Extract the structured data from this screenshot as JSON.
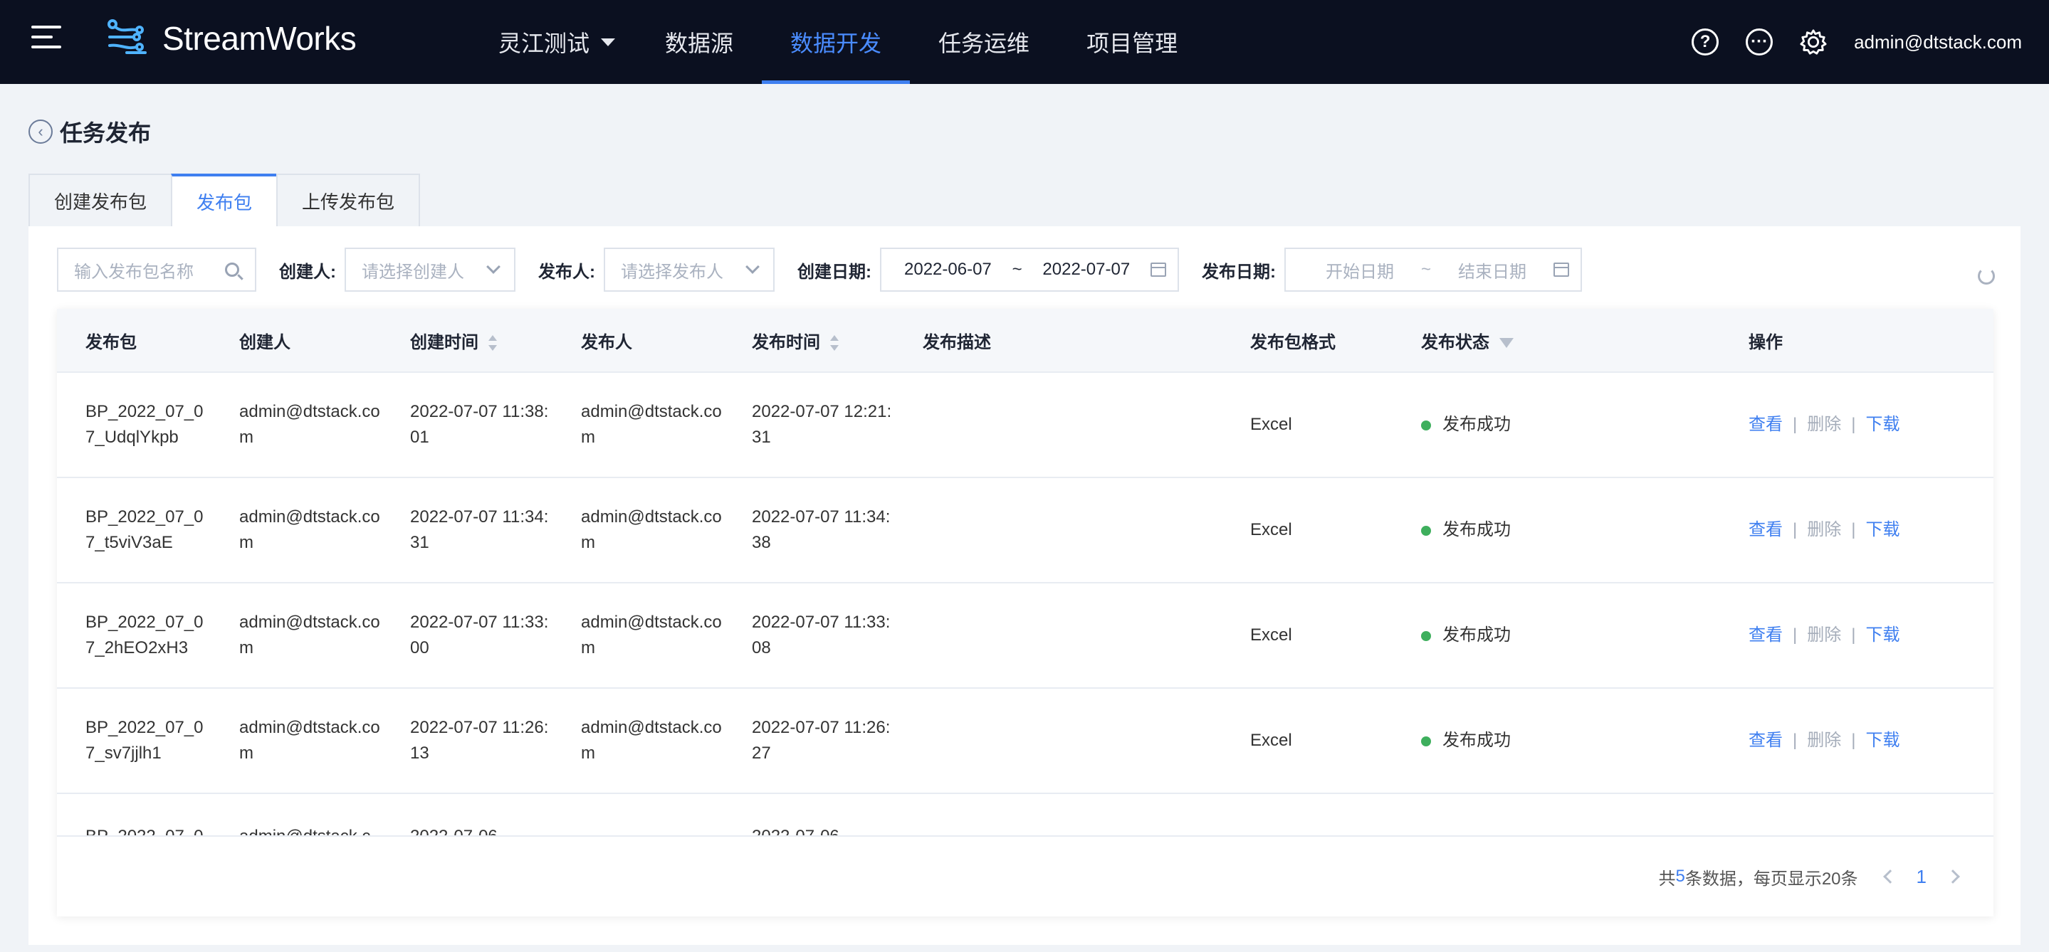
{
  "app": {
    "name": "StreamWorks"
  },
  "nav": {
    "project": "灵江测试",
    "items": [
      "数据源",
      "数据开发",
      "任务运维",
      "项目管理"
    ],
    "active": "数据开发"
  },
  "user": {
    "email": "admin@dtstack.com"
  },
  "page": {
    "title": "任务发布"
  },
  "tabs": [
    {
      "label": "创建发布包",
      "active": false
    },
    {
      "label": "发布包",
      "active": true
    },
    {
      "label": "上传发布包",
      "active": false
    }
  ],
  "filters": {
    "search_placeholder": "输入发布包名称",
    "creator_label": "创建人:",
    "creator_placeholder": "请选择创建人",
    "publisher_label": "发布人:",
    "publisher_placeholder": "请选择发布人",
    "create_date_label": "创建日期:",
    "create_date_start": "2022-06-07",
    "create_date_sep": "~",
    "create_date_end": "2022-07-07",
    "publish_date_label": "发布日期:",
    "publish_date_start": "开始日期",
    "publish_date_sep": "~",
    "publish_date_end": "结束日期"
  },
  "table": {
    "headers": {
      "package": "发布包",
      "creator": "创建人",
      "create_time": "创建时间",
      "publisher": "发布人",
      "publish_time": "发布时间",
      "description": "发布描述",
      "format": "发布包格式",
      "status": "发布状态",
      "actions": "操作"
    },
    "rows": [
      {
        "package": "BP_2022_07_07_UdqlYkpb",
        "creator": "admin@dtstack.com",
        "create_time": "2022-07-07 11:38:01",
        "publisher": "admin@dtstack.com",
        "publish_time": "2022-07-07 12:21:31",
        "description": "",
        "format": "Excel",
        "status": "发布成功"
      },
      {
        "package": "BP_2022_07_07_t5viV3aE",
        "creator": "admin@dtstack.com",
        "create_time": "2022-07-07 11:34:31",
        "publisher": "admin@dtstack.com",
        "publish_time": "2022-07-07 11:34:38",
        "description": "",
        "format": "Excel",
        "status": "发布成功"
      },
      {
        "package": "BP_2022_07_07_2hEO2xH3",
        "creator": "admin@dtstack.com",
        "create_time": "2022-07-07 11:33:00",
        "publisher": "admin@dtstack.com",
        "publish_time": "2022-07-07 11:33:08",
        "description": "",
        "format": "Excel",
        "status": "发布成功"
      },
      {
        "package": "BP_2022_07_07_sv7jjlh1",
        "creator": "admin@dtstack.com",
        "create_time": "2022-07-07 11:26:13",
        "publisher": "admin@dtstack.com",
        "publish_time": "2022-07-07 11:26:27",
        "description": "",
        "format": "Excel",
        "status": "发布成功"
      },
      {
        "package": "BP_2022_07_0",
        "creator": "admin@dtstack.c",
        "create_time": "2022-07-06",
        "publisher": "",
        "publish_time": "2022-07-06",
        "description": "",
        "format": "",
        "status": ""
      }
    ],
    "actions": {
      "view": "查看",
      "delete": "删除",
      "download": "下载",
      "sep": "|"
    }
  },
  "pagination": {
    "prefix": "共",
    "total": "5",
    "suffix": "条数据，每页显示20条",
    "current_page": "1"
  },
  "colors": {
    "accent": "#3f7ff0",
    "success": "#3eaf5d",
    "topbar": "#0b1020"
  }
}
